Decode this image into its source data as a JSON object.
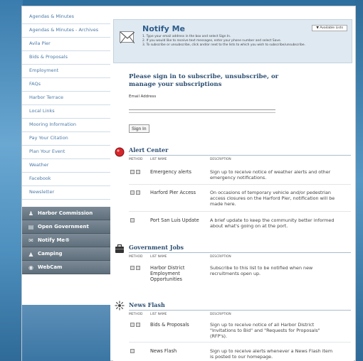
{
  "sidebar": {
    "links": [
      "Agendas & Minutes",
      "Agendas & Minutes - Archives",
      "Avila Pier",
      "Bids & Proposals",
      "Employment",
      "FAQs",
      "Harbor Terrace",
      "Local Links",
      "Mooring Information",
      "Pay Your Citation",
      "Plan Your Event",
      "Weather",
      "Facebook",
      "Newsletter"
    ],
    "dark_menu": [
      {
        "label": "Harbor Commission",
        "icon": "people-icon"
      },
      {
        "label": "Open Government",
        "icon": "document-icon"
      },
      {
        "label": "Notify Me®",
        "icon": "mail-icon"
      },
      {
        "label": "Camping",
        "icon": "camper-icon"
      },
      {
        "label": "WebCam",
        "icon": "camera-icon"
      }
    ]
  },
  "notify": {
    "title": "Notify Me",
    "step1": "1. Type your email address in the box and select Sign In.",
    "step2": "2. If you would like to receive text messages, enter your phone number and select Save.",
    "step3": "3. To subscribe or unsubscribe, click  and/or  next to the lists to which you wish to subscribe/unsubscribe.",
    "available_lists": "▼ Available Lists"
  },
  "signin": {
    "heading": "Please sign in to subscribe, unsubscribe, or manage your subscriptions",
    "email_label": "Email Address",
    "button": "Sign In"
  },
  "columns": {
    "method": "METHOD",
    "list_name": "LIST NAME",
    "description": "DESCRIPTION"
  },
  "sections": [
    {
      "title": "Alert Center",
      "rows": [
        {
          "name": "Emergency alerts",
          "desc": "Sign up to receive notice of weather alerts and other emergency notifications."
        },
        {
          "name": "Harford Pier Access",
          "desc": "On occasions of temporary vehicle and/or pedestrian access closures on the Harford Pier, notification will be made here."
        },
        {
          "name": "Port San Luis Update",
          "desc": "A brief update to keep the community better informed about what's going on at the port."
        }
      ]
    },
    {
      "title": "Government Jobs",
      "rows": [
        {
          "name": "Harbor District Employment Opportunities",
          "desc": "Subscribe to this list to be notified when new recruitments open up."
        }
      ]
    },
    {
      "title": "News Flash",
      "rows": [
        {
          "name": "Bids & Proposals",
          "desc": "Sign up to receive notice of all Harbor District \"Invitations to Bid\" and \"Requests for Proposals\" (RFP's)."
        },
        {
          "name": "News Flash",
          "desc": "Sign up to receive alerts whenever a News Flash item is posted to our homepage."
        }
      ]
    }
  ]
}
